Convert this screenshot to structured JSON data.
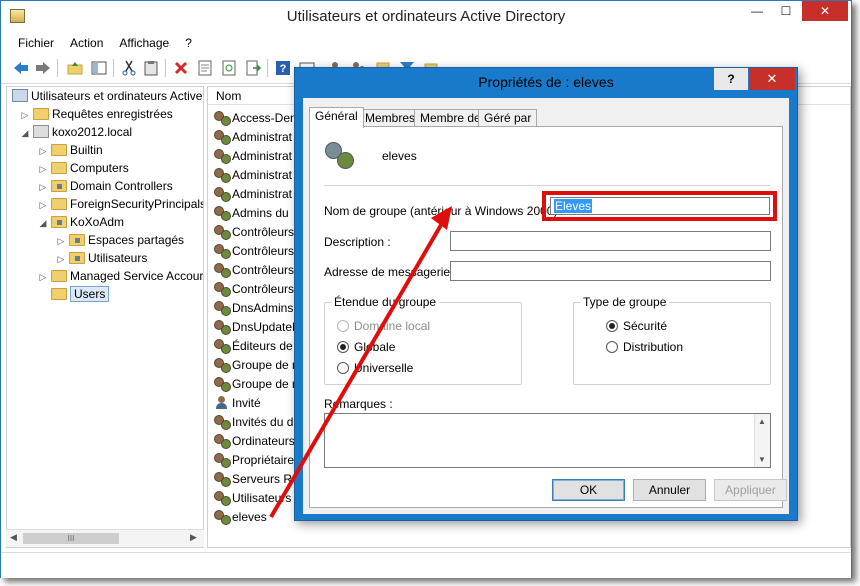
{
  "window": {
    "title": "Utilisateurs et ordinateurs Active Directory",
    "minimize": "—",
    "maximize": "☐",
    "close": "✕"
  },
  "menu": [
    "Fichier",
    "Action",
    "Affichage",
    "?"
  ],
  "toolbar_icons": [
    "back-arrow-icon",
    "forward-arrow-icon",
    "up-folder-icon",
    "console-tree-icon",
    "cut-icon",
    "paste-icon",
    "delete-icon",
    "properties-icon",
    "refresh-icon",
    "export-icon",
    "help-icon",
    "view-icon",
    "new-user-icon",
    "new-group-icon",
    "find-icon",
    "filter-icon",
    "add-to-group-icon"
  ],
  "tree": {
    "items": [
      {
        "label": "Utilisateurs et ordinateurs Active",
        "type": "root",
        "expander": "",
        "level": 0
      },
      {
        "label": "Requêtes enregistrées",
        "type": "folder",
        "expander": "▷",
        "level": 1
      },
      {
        "label": "koxo2012.local",
        "type": "domain",
        "expander": "◢",
        "level": 1
      },
      {
        "label": "Builtin",
        "type": "folder",
        "expander": "▷",
        "level": 2
      },
      {
        "label": "Computers",
        "type": "folder",
        "expander": "▷",
        "level": 2
      },
      {
        "label": "Domain Controllers",
        "type": "ou",
        "expander": "▷",
        "level": 2
      },
      {
        "label": "ForeignSecurityPrincipals",
        "type": "folder",
        "expander": "▷",
        "level": 2
      },
      {
        "label": "KoXoAdm",
        "type": "ou",
        "expander": "◢",
        "level": 2
      },
      {
        "label": "Espaces partagés",
        "type": "ou",
        "expander": "▷",
        "level": 3
      },
      {
        "label": "Utilisateurs",
        "type": "ou",
        "expander": "▷",
        "level": 3
      },
      {
        "label": "Managed Service Accour",
        "type": "folder",
        "expander": "▷",
        "level": 2
      },
      {
        "label": "Users",
        "type": "folder",
        "expander": "",
        "level": 2,
        "selected": true
      }
    ],
    "hscroll_thumb": "III"
  },
  "list": {
    "header": "Nom",
    "rows": [
      {
        "label": "Access-Den",
        "icon": "group"
      },
      {
        "label": "Administrat",
        "icon": "group"
      },
      {
        "label": "Administrat",
        "icon": "group"
      },
      {
        "label": "Administrat",
        "icon": "group"
      },
      {
        "label": "Administrat",
        "icon": "group"
      },
      {
        "label": "Admins du",
        "icon": "group"
      },
      {
        "label": "Contrôleurs",
        "icon": "group"
      },
      {
        "label": "Contrôleurs",
        "icon": "group"
      },
      {
        "label": "Contrôleurs",
        "icon": "group"
      },
      {
        "label": "Contrôleurs",
        "icon": "group"
      },
      {
        "label": "DnsAdmins",
        "icon": "group"
      },
      {
        "label": "DnsUpdateP",
        "icon": "group"
      },
      {
        "label": "Éditeurs de",
        "icon": "group"
      },
      {
        "label": "Groupe de r",
        "icon": "group"
      },
      {
        "label": "Groupe de r",
        "icon": "group"
      },
      {
        "label": "Invité",
        "icon": "user"
      },
      {
        "label": "Invités du d",
        "icon": "group"
      },
      {
        "label": "Ordinateurs",
        "icon": "group"
      },
      {
        "label": "Propriétaire",
        "icon": "group"
      },
      {
        "label": "Serveurs RA",
        "icon": "group"
      },
      {
        "label": "Utilisateurs",
        "icon": "group"
      },
      {
        "label": "eleves",
        "icon": "group"
      }
    ]
  },
  "dialog": {
    "title": "Propriétés de : eleves",
    "help": "?",
    "close": "✕",
    "tabs": [
      "Général",
      "Membres",
      "Membre de",
      "Géré par"
    ],
    "group_name": "eleves",
    "pre2000_label": "Nom de groupe (antérieur à Windows 2000) :",
    "pre2000_value": "Eleves",
    "description_label": "Description :",
    "description_value": "",
    "email_label": "Adresse de messagerie :",
    "email_value": "",
    "scope": {
      "label": "Étendue du groupe",
      "options": [
        {
          "label": "Domaine local",
          "checked": false,
          "disabled": true
        },
        {
          "label": "Globale",
          "checked": true,
          "disabled": false
        },
        {
          "label": "Universelle",
          "checked": false,
          "disabled": false
        }
      ]
    },
    "type": {
      "label": "Type de groupe",
      "options": [
        {
          "label": "Sécurité",
          "checked": true
        },
        {
          "label": "Distribution",
          "checked": false
        }
      ]
    },
    "notes_label": "Remarques :",
    "notes_value": "",
    "buttons": {
      "ok": "OK",
      "cancel": "Annuler",
      "apply": "Appliquer"
    }
  },
  "annotation": {
    "color": "#e00d0d"
  }
}
